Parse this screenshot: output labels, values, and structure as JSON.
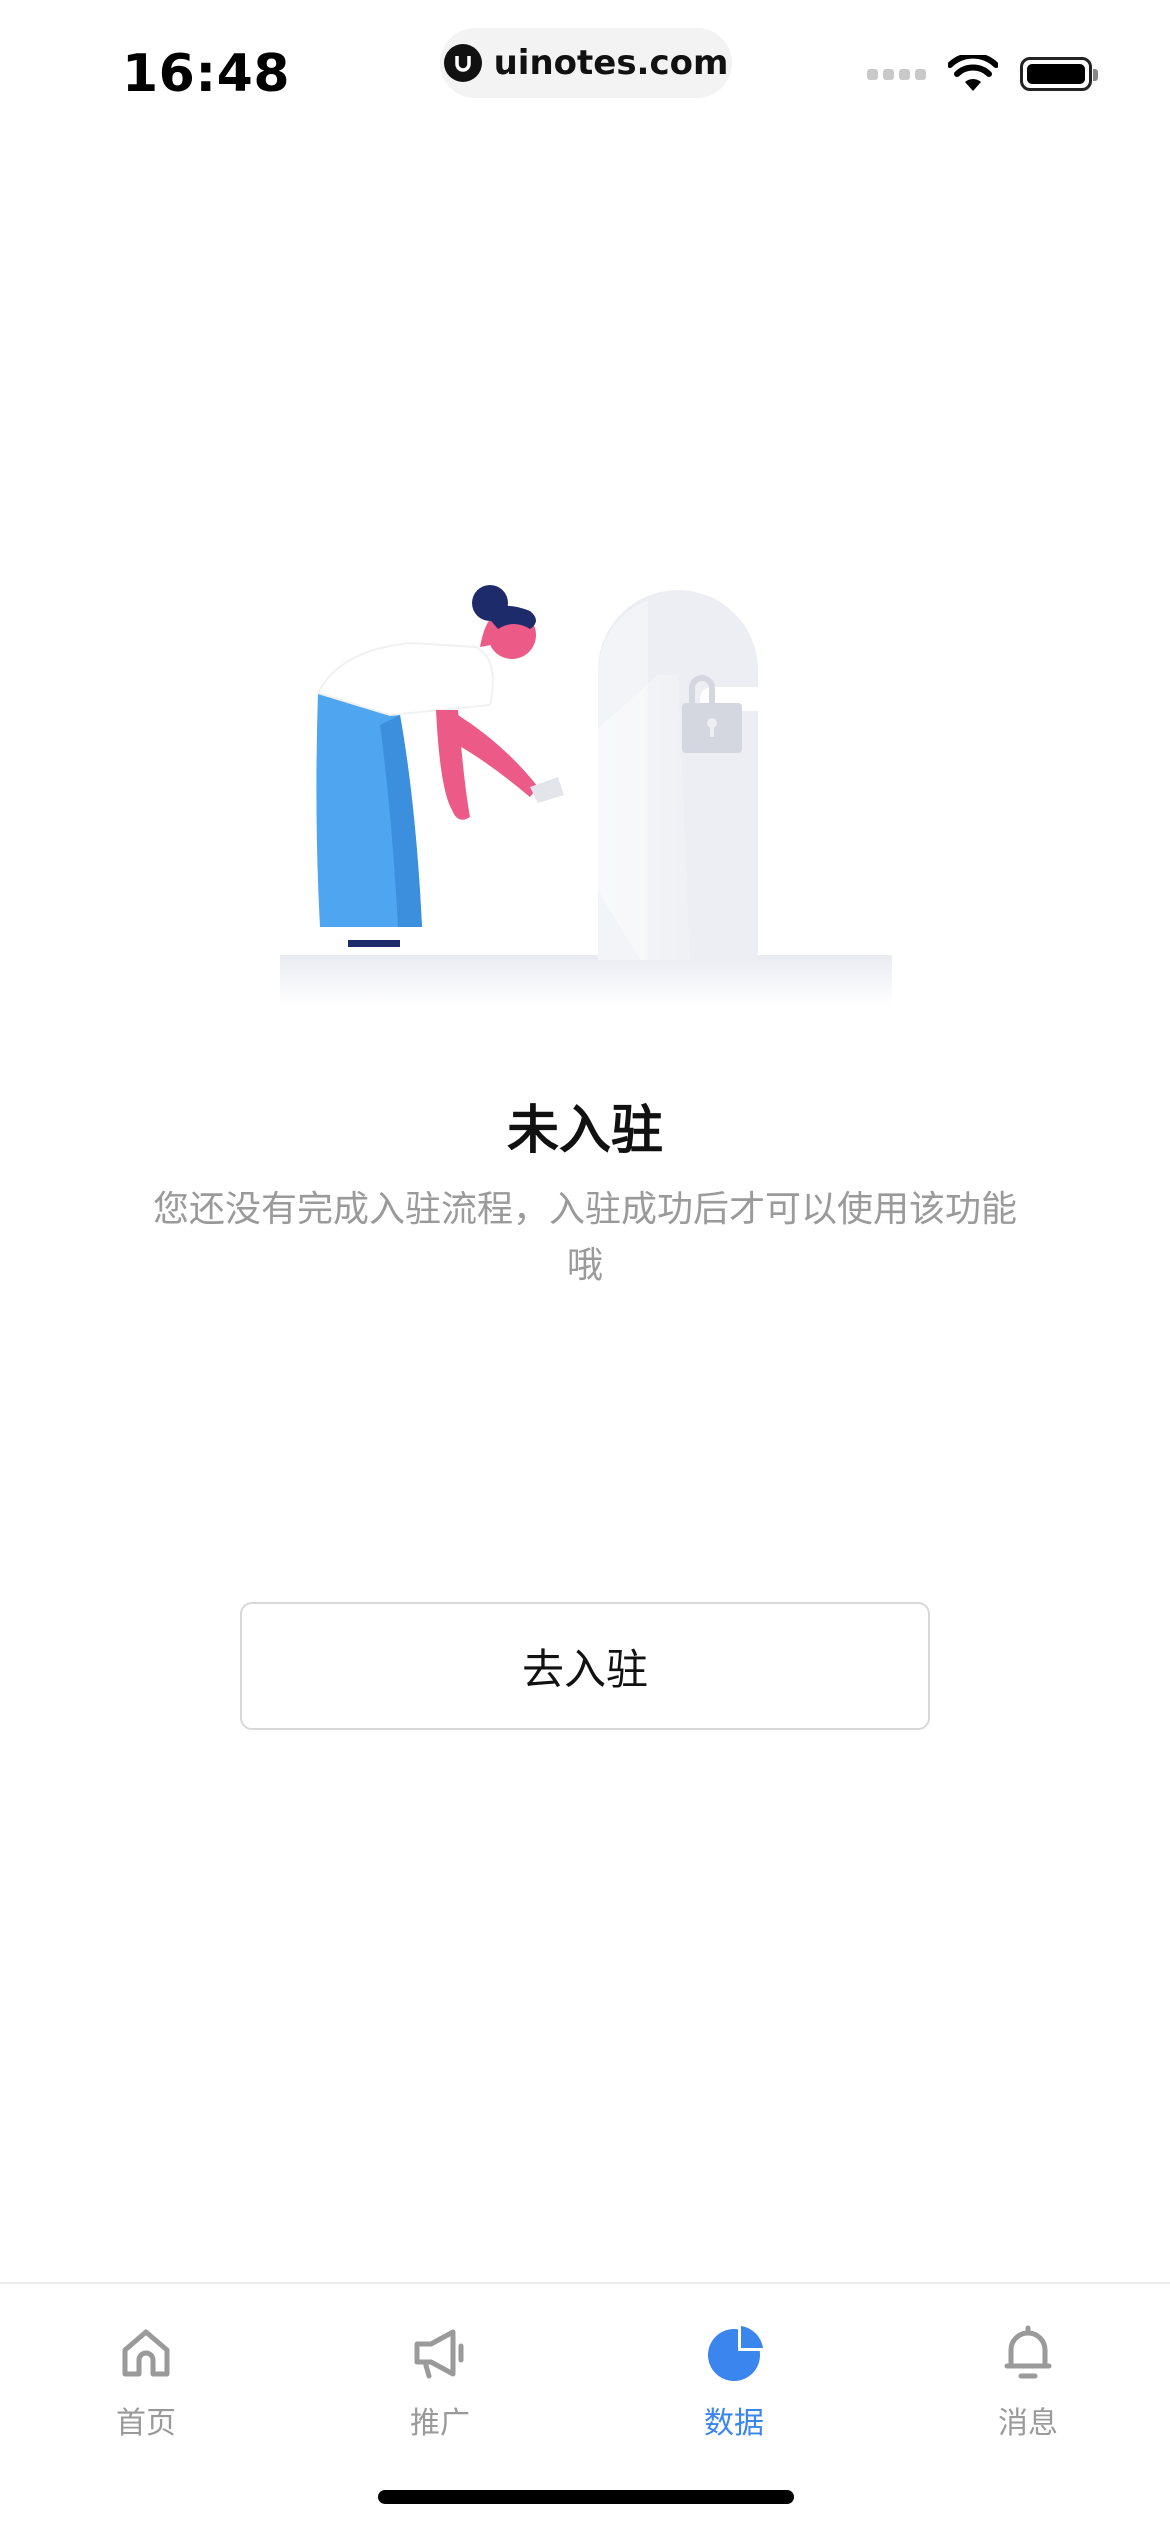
{
  "status_bar": {
    "time": "16:48",
    "url": "uinotes.com"
  },
  "empty_state": {
    "title": "未入驻",
    "description": "您还没有完成入驻流程，入驻成功后才可以使用该功能哦"
  },
  "action": {
    "join_label": "去入驻"
  },
  "tabs": [
    {
      "label": "首页",
      "icon": "home-icon",
      "active": false
    },
    {
      "label": "推广",
      "icon": "megaphone-icon",
      "active": false
    },
    {
      "label": "数据",
      "icon": "pie-chart-icon",
      "active": true
    },
    {
      "label": "消息",
      "icon": "bell-icon",
      "active": false
    }
  ],
  "colors": {
    "accent": "#3a85ee",
    "inactive": "#9a9a9a"
  }
}
